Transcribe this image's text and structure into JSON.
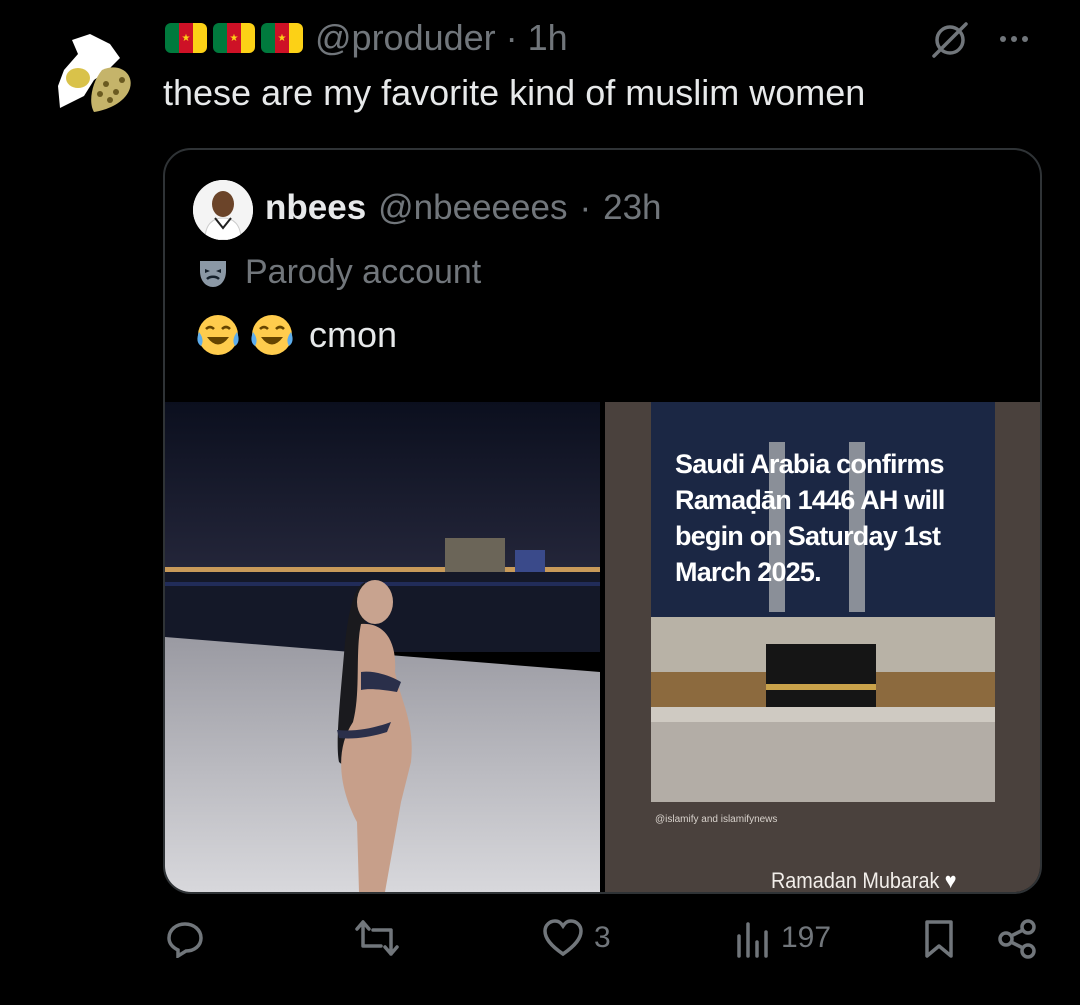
{
  "post": {
    "handle": "@produder",
    "time": "1h",
    "text": "these are my favorite kind of muslim women"
  },
  "quote": {
    "name": "nbees",
    "handle": "@nbeeeees",
    "time": "23h",
    "label": "Parody account",
    "text": "cmon",
    "media_right": {
      "headline": "Saudi Arabia confirms Ramaḍān 1446 AH will begin on Saturday 1st March 2025.",
      "credit": "@islamify and islamifynews",
      "caption": "Ramadan Mubarak"
    }
  },
  "actions": {
    "likes": "3",
    "views": "197"
  },
  "icons": [
    "cameroon-flag-icon",
    "slash-circle-icon",
    "more-icon",
    "parody-mask-icon",
    "laughing-crying-emoji",
    "reply-icon",
    "retweet-icon",
    "like-icon",
    "views-icon",
    "bookmark-icon",
    "share-icon"
  ],
  "colors": {
    "background": "#000000",
    "text": "#e7e9ea",
    "muted": "#71767b",
    "border": "#2f3336"
  }
}
